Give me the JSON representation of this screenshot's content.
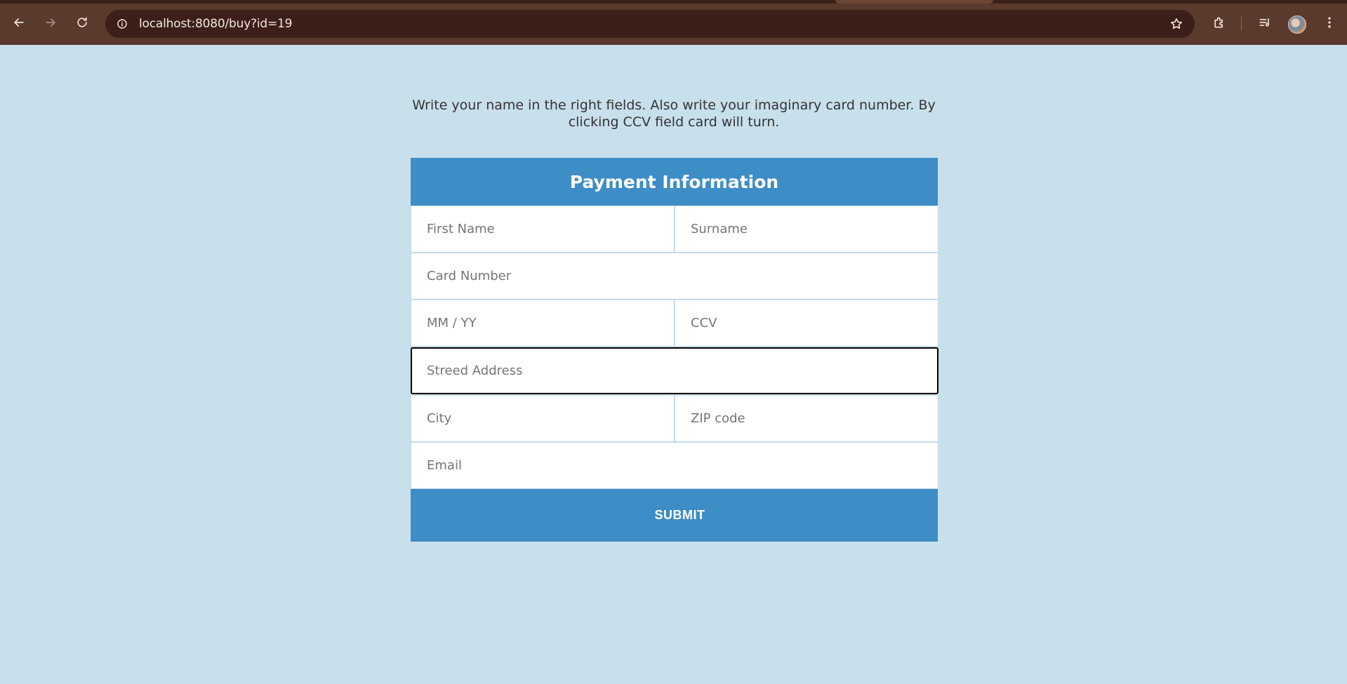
{
  "browser": {
    "url": "localhost:8080/buy?id=19",
    "icons": [
      "back-arrow-icon",
      "forward-arrow-icon",
      "reload-icon",
      "site-info-icon",
      "star-icon",
      "extensions-icon",
      "media-controls-icon",
      "avatar",
      "more-vert-icon"
    ]
  },
  "page": {
    "intro": "Write your name in the right fields. Also write your imaginary card number. By clicking CCV field card will turn.",
    "form_title": "Payment Information",
    "fields": {
      "first_name": "First Name",
      "surname": "Surname",
      "card_number": "Card Number",
      "expiry": "MM / YY",
      "ccv": "CCV",
      "street": "Streed Address",
      "city": "City",
      "zip": "ZIP code",
      "email": "Email"
    },
    "submit_label": "SUBMIT"
  },
  "colors": {
    "page_bg": "#c8dfec",
    "accent": "#3d8dc7",
    "browser_bar": "#5b3a2e",
    "omnibox": "#3c1f18"
  }
}
